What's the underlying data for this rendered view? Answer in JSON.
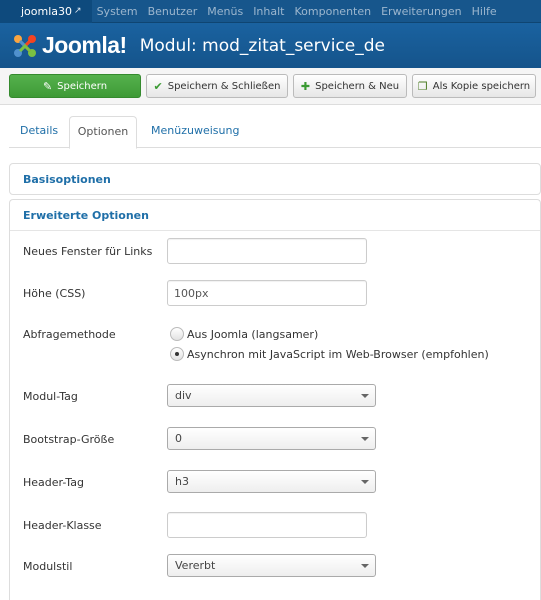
{
  "topbar": {
    "site_name": "joomla30",
    "menu": [
      "System",
      "Benutzer",
      "Menüs",
      "Inhalt",
      "Komponenten",
      "Erweiterungen",
      "Hilfe"
    ]
  },
  "header": {
    "logo_text": "Joomla!",
    "title": "Modul: mod_zitat_service_de"
  },
  "toolbar": {
    "save": "Speichern",
    "save_close": "Speichern & Schließen",
    "save_new": "Speichern & Neu",
    "save_copy": "Als Kopie speichern"
  },
  "tabs": {
    "details": "Details",
    "options": "Optionen",
    "menu_assignment": "Menüzuweisung"
  },
  "panels": {
    "basic": "Basisoptionen",
    "advanced": "Erweiterte Optionen"
  },
  "form": {
    "new_window": {
      "label": "Neues Fenster für Links",
      "value": ""
    },
    "height": {
      "label": "Höhe (CSS)",
      "value": "100px"
    },
    "query_method": {
      "label": "Abfragemethode",
      "options": [
        "Aus Joomla (langsamer)",
        "Asynchron mit JavaScript im Web-Browser (empfohlen)"
      ],
      "selected_index": 1
    },
    "module_tag": {
      "label": "Modul-Tag",
      "value": "div"
    },
    "bootstrap_size": {
      "label": "Bootstrap-Größe",
      "value": "0"
    },
    "header_tag": {
      "label": "Header-Tag",
      "value": "h3"
    },
    "header_class": {
      "label": "Header-Klasse",
      "value": ""
    },
    "module_style": {
      "label": "Modulstil",
      "value": "Vererbt"
    }
  },
  "colors": {
    "topbar": "#17568c",
    "header": "#1a62a0",
    "save_button": "#46a53e",
    "link": "#1f6fa8"
  }
}
